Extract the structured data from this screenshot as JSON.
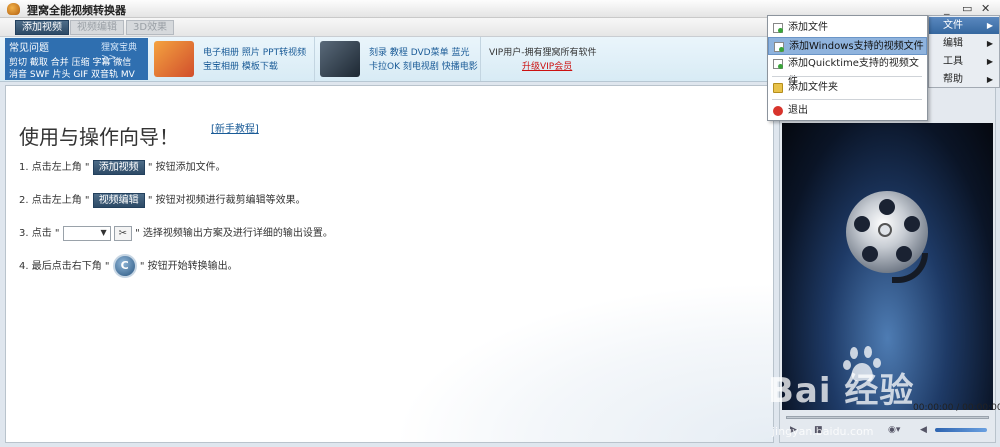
{
  "window": {
    "title": "狸窝全能视频转换器",
    "minimize_glyph": "_",
    "restore_glyph": "▭",
    "close_glyph": "✕"
  },
  "toolbar": {
    "add_video": "添加视频",
    "edit_video": "视频编辑",
    "effects_3d": "3D效果"
  },
  "menubar": {
    "items": [
      {
        "label": "文件",
        "highlighted": true
      },
      {
        "label": "编辑",
        "highlighted": false
      },
      {
        "label": "工具",
        "highlighted": false
      },
      {
        "label": "帮助",
        "highlighted": false
      }
    ]
  },
  "file_menu": {
    "items": [
      {
        "label": "添加文件",
        "icon": "add-file-icon"
      },
      {
        "label": "添加Windows支持的视频文件",
        "icon": "add-file-icon",
        "highlighted": true
      },
      {
        "label": "添加Quicktime支持的视频文件",
        "icon": "add-file-icon"
      },
      {
        "label": "添加文件夹",
        "icon": "folder-icon"
      },
      {
        "label": "退出",
        "icon": "exit-icon"
      }
    ]
  },
  "ads": {
    "faq_title": "常见问题",
    "faq_link": "狸窝宝典>>",
    "faq_line1": "剪切 截取 合并 压缩 字幕 微信",
    "faq_line2": "消音 SWF 片头 GIF 双音轨 MV",
    "block1_line1": "电子相册 照片 PPT转视频",
    "block1_line2": "宝宝相册 模板下载",
    "block2_line1": "刻录 教程 DVD菜单 蓝光",
    "block2_line2": "卡拉OK 刻电视剧 快播电影",
    "vip_line": "VIP用户-拥有狸窝所有软件",
    "vip_link": "升级VIP会员"
  },
  "guide": {
    "title": "使用与操作向导！",
    "tutorial_link": "[新手教程]",
    "step1_pre": "1. 点击左上角 \"",
    "step1_btn": "添加视频",
    "step1_post": "\" 按钮添加文件。",
    "step2_pre": "2. 点击左上角 \"",
    "step2_btn": "视频编辑",
    "step2_post": "\" 按钮对视频进行裁剪编辑等效果。",
    "step3_pre": "3. 点击 \"",
    "step3_post": "\" 选择视频输出方案及进行详细的输出设置。",
    "step4_pre": "4. 最后点击右下角 \"",
    "step4_post": "\" 按钮开始转换输出。"
  },
  "preview": {
    "time_readout": "00:00:00 / 00:00:00"
  },
  "watermark": {
    "brand": "Bai  经验",
    "url": "jingyan.baidu.com"
  },
  "colors": {
    "accent": "#2d4a66",
    "menu_highlight": "#35679f",
    "faq_bg": "#2f6fb0",
    "vip_link": "#cc1111"
  }
}
